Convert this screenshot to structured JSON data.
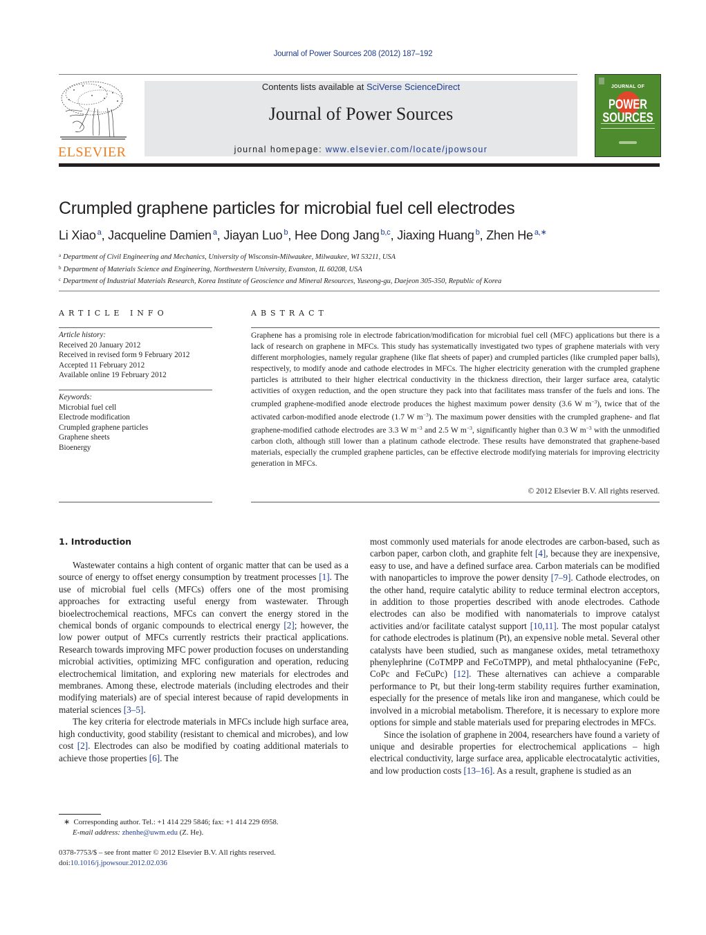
{
  "header": {
    "journal_reference": "Journal of Power Sources 208 (2012) 187–192",
    "contents_prefix": "Contents lists available at ",
    "contents_link": "SciVerse ScienceDirect",
    "journal_title": "Journal of Power Sources",
    "homepage_prefix": "journal homepage: ",
    "homepage_link": "www.elsevier.com/locate/jpowsour",
    "publisher_logo_text": "ELSEVIER",
    "cover": {
      "top_text": "JOURNAL OF",
      "main_text": "POWER SOURCES",
      "colors": {
        "background": "#4e8a2e",
        "sun": "#e0462a"
      }
    }
  },
  "article": {
    "title": "Crumpled graphene particles for microbial fuel cell electrodes",
    "authors": [
      {
        "name": "Li Xiao",
        "sup": "a"
      },
      {
        "name": "Jacqueline Damien",
        "sup": "a"
      },
      {
        "name": "Jiayan Luo",
        "sup": "b"
      },
      {
        "name": "Hee Dong Jang",
        "sup": "b,c"
      },
      {
        "name": "Jiaxing Huang",
        "sup": "b"
      },
      {
        "name": "Zhen He",
        "sup": "a,∗"
      }
    ],
    "affiliations": [
      {
        "sup": "a",
        "text": "Department of Civil Engineering and Mechanics, University of Wisconsin-Milwaukee, Milwaukee, WI 53211, USA"
      },
      {
        "sup": "b",
        "text": "Department of Materials Science and Engineering, Northwestern University, Evanston, IL 60208, USA"
      },
      {
        "sup": "c",
        "text": "Department of Industrial Materials Research, Korea Institute of Geoscience and Mineral Resources, Yuseong-gu, Daejeon 305-350, Republic of Korea"
      }
    ]
  },
  "article_info": {
    "heading": "ARTICLE INFO",
    "history_label": "Article history:",
    "history": [
      "Received 20 January 2012",
      "Received in revised form 9 February 2012",
      "Accepted 11 February 2012",
      "Available online 19 February 2012"
    ],
    "keywords_label": "Keywords:",
    "keywords": [
      "Microbial fuel cell",
      "Electrode modification",
      "Crumpled graphene particles",
      "Graphene sheets",
      "Bioenergy"
    ]
  },
  "abstract": {
    "heading": "ABSTRACT",
    "part1": "Graphene has a promising role in electrode fabrication/modification for microbial fuel cell (MFC) applications but there is a lack of research on graphene in MFCs. This study has systematically investigated two types of graphene materials with very different morphologies, namely regular graphene (like flat sheets of paper) and crumpled particles (like crumpled paper balls), respectively, to modify anode and cathode electrodes in MFCs. The higher electricity generation with the crumpled graphene particles is attributed to their higher electrical conductivity in the thickness direction, their larger surface area, catalytic activities of oxygen reduction, and the open structure they pack into that facilitates mass transfer of the fuels and ions. The crumpled graphene-modified anode electrode produces the highest maximum power density (3.6 W m",
    "part2": "), twice that of the activated carbon-modified anode electrode (1.7 W m",
    "part3": "). The maximum power densities with the crumpled graphene- and flat graphene-modified cathode electrodes are 3.3 W m",
    "part4": " and 2.5 W m",
    "part5": ", significantly higher than 0.3 W m",
    "part6": " with the unmodified carbon cloth, although still lower than a platinum cathode electrode. These results have demonstrated that graphene-based materials, especially the crumpled graphene particles, can be effective electrode modifying materials for improving electricity generation in MFCs.",
    "unit_exponent": "−3",
    "copyright": "© 2012 Elsevier B.V. All rights reserved."
  },
  "introduction": {
    "heading": "1.  Introduction",
    "left": {
      "p1_a": "Wastewater contains a high content of organic matter that can be used as a source of energy to offset energy consumption by treatment processes ",
      "ref1": "[1]",
      "p1_b": ". The use of microbial fuel cells (MFCs) offers one of the most promising approaches for extracting useful energy from wastewater. Through bioelectrochemical reactions, MFCs can convert the energy stored in the chemical bonds of organic compounds to electrical energy ",
      "ref2": "[2]",
      "p1_c": "; however, the low power output of MFCs currently restricts their practical applications. Research towards improving MFC power production focuses on understanding microbial activities, optimizing MFC configuration and operation, reducing electrochemical limitation, and exploring new materials for electrodes and membranes. Among these, electrode materials (including electrodes and their modifying materials) are of special interest because of rapid developments in material sciences ",
      "ref3": "[3–5]",
      "p1_d": ".",
      "p2_a": "The key criteria for electrode materials in MFCs include high surface area, high conductivity, good stability (resistant to chemical and microbes), and low cost ",
      "ref4": "[2]",
      "p2_b": ". Electrodes can also be modified by coating additional materials to achieve those properties ",
      "ref5": "[6]",
      "p2_c": ". The"
    },
    "right": {
      "p1_a": "most commonly used materials for anode electrodes are carbon-based, such as carbon paper, carbon cloth, and graphite felt ",
      "ref1": "[4]",
      "p1_b": ", because they are inexpensive, easy to use, and have a defined surface area. Carbon materials can be modified with nanoparticles to improve the power density ",
      "ref2": "[7–9]",
      "p1_c": ". Cathode electrodes, on the other hand, require catalytic ability to reduce terminal electron acceptors, in addition to those properties described with anode electrodes. Cathode electrodes can also be modified with nanomaterials to improve catalyst activities and/or facilitate catalyst support ",
      "ref3": "[10,11]",
      "p1_d": ". The most popular catalyst for cathode electrodes is platinum (Pt), an expensive noble metal. Several other catalysts have been studied, such as manganese oxides, metal tetramethoxy phenylephrine (CoTMPP and FeCoTMPP), and metal phthalocyanine (FePc, CoPc and FeCuPc) ",
      "ref4": "[12]",
      "p1_e": ". These alternatives can achieve a comparable performance to Pt, but their long-term stability requires further examination, especially for the presence of metals like iron and manganese, which could be involved in a microbial metabolism. Therefore, it is necessary to explore more options for simple and stable materials used for preparing electrodes in MFCs.",
      "p2_a": "Since the isolation of graphene in 2004, researchers have found a variety of unique and desirable properties for electrochemical applications – high electrical conductivity, large surface area, applicable electrocatalytic activities, and low production costs ",
      "ref5": "[13–16]",
      "p2_b": ". As a result, graphene is studied as an"
    }
  },
  "footnotes": {
    "corresponding_marker": "∗",
    "corresponding_text": "Corresponding author. Tel.: +1 414 229 5846; fax: +1 414 229 6958.",
    "email_label": "E-mail address:",
    "email": "zhenhe@uwm.edu",
    "email_suffix": " (Z. He).",
    "front_matter": "0378-7753/$ – see front matter © 2012 Elsevier B.V. All rights reserved.",
    "doi_prefix": "doi:",
    "doi": "10.1016/j.jpowsour.2012.02.036"
  },
  "colors": {
    "link": "#1f3d8f",
    "elsevier_orange": "#f07e22",
    "banner_gray": "#e6e7e8"
  }
}
